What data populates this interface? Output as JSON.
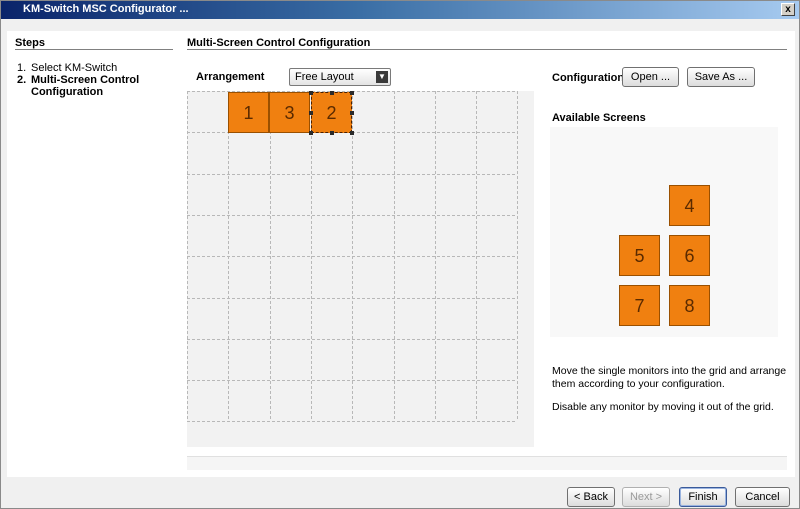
{
  "window": {
    "title": "KM-Switch MSC Configurator ...",
    "close_glyph": "x"
  },
  "steps": {
    "title": "Steps",
    "items": [
      {
        "num": "1.",
        "label": "Select KM-Switch"
      },
      {
        "num": "2.",
        "label": "Multi-Screen Control Configuration"
      }
    ]
  },
  "main": {
    "title": "Multi-Screen Control Configuration",
    "arrangement_label": "Arrangement",
    "arrangement_value": "Free Layout",
    "arrangement_arrow": "▼"
  },
  "configuration": {
    "label": "Configuration",
    "open_label": "Open ...",
    "save_as_label": "Save As ..."
  },
  "grid": {
    "placed_screens": [
      {
        "label": "1",
        "col": 1,
        "row": 0
      },
      {
        "label": "3",
        "col": 2,
        "row": 0
      },
      {
        "label": "2",
        "col": 3,
        "row": 0,
        "selected": true
      }
    ]
  },
  "available": {
    "title": "Available Screens",
    "screens": [
      "4",
      "5",
      "6",
      "7",
      "8"
    ]
  },
  "hints": {
    "line1": "Move the single monitors into the grid and arrange them according to your configuration.",
    "line2": "Disable any monitor by moving it out of the grid."
  },
  "footer": {
    "back_label": "< Back",
    "next_label": "Next >",
    "finish_label": "Finish",
    "cancel_label": "Cancel"
  },
  "colors": {
    "tile": "#f08010",
    "title_bar": "#0a246a"
  }
}
